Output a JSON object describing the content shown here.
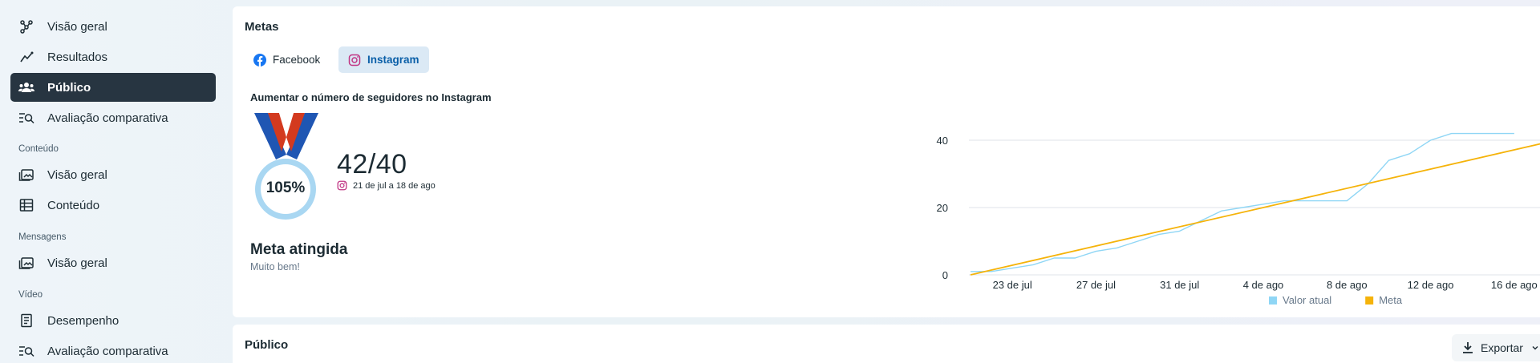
{
  "sidebar": {
    "items": [
      {
        "label": "Visão geral",
        "icon": "nodes-icon"
      },
      {
        "label": "Resultados",
        "icon": "trend-icon"
      },
      {
        "label": "Público",
        "icon": "people-icon",
        "active": true
      },
      {
        "label": "Avaliação comparativa",
        "icon": "benchmark-search-icon"
      }
    ],
    "sections": [
      {
        "title": "Conteúdo",
        "items": [
          {
            "label": "Visão geral",
            "icon": "gallery-icon"
          },
          {
            "label": "Conteúdo",
            "icon": "table-icon"
          }
        ]
      },
      {
        "title": "Mensagens",
        "items": [
          {
            "label": "Visão geral",
            "icon": "gallery-icon"
          }
        ]
      },
      {
        "title": "Vídeo",
        "items": [
          {
            "label": "Desempenho",
            "icon": "document-icon"
          },
          {
            "label": "Avaliação comparativa",
            "icon": "benchmark-search-icon"
          }
        ]
      }
    ]
  },
  "goals": {
    "title": "Metas",
    "tabs": [
      {
        "label": "Facebook",
        "icon": "facebook-icon",
        "selected": false
      },
      {
        "label": "Instagram",
        "icon": "instagram-icon",
        "selected": true
      }
    ],
    "goal_heading": "Aumentar o número de seguidores no Instagram",
    "percent": "105%",
    "progress": "42/40",
    "current": 42,
    "target": 40,
    "date_range": "21 de jul a 18 de ago",
    "status_title": "Meta atingida",
    "status_sub": "Muito bem!"
  },
  "audience": {
    "title": "Público",
    "export_label": "Exportar"
  },
  "colors": {
    "accent_dark": "#273541",
    "current_line": "#8fd6f5",
    "goal_line": "#f5b30a",
    "instagram": "#c13584",
    "facebook": "#1877f2"
  },
  "chart_data": {
    "type": "line",
    "x_ticks": [
      "23 de jul",
      "27 de jul",
      "31 de jul",
      "4 de ago",
      "8 de ago",
      "12 de ago",
      "16 de ago"
    ],
    "y_ticks": [
      0,
      20,
      40
    ],
    "ylim": [
      0,
      40
    ],
    "x_start": "21 de jul",
    "x_end": "18 de ago",
    "grid": true,
    "legend_position": "bottom",
    "series": [
      {
        "name": "Valor atual",
        "color": "#8fd6f5",
        "points": [
          [
            "21 de jul",
            1
          ],
          [
            "22 de jul",
            1
          ],
          [
            "23 de jul",
            2
          ],
          [
            "24 de jul",
            3
          ],
          [
            "25 de jul",
            5
          ],
          [
            "26 de jul",
            5
          ],
          [
            "27 de jul",
            7
          ],
          [
            "28 de jul",
            8
          ],
          [
            "29 de jul",
            10
          ],
          [
            "30 de jul",
            12
          ],
          [
            "31 de jul",
            13
          ],
          [
            "1 de ago",
            16
          ],
          [
            "2 de ago",
            19
          ],
          [
            "3 de ago",
            20
          ],
          [
            "4 de ago",
            21
          ],
          [
            "5 de ago",
            22
          ],
          [
            "6 de ago",
            22
          ],
          [
            "7 de ago",
            22
          ],
          [
            "8 de ago",
            22
          ],
          [
            "9 de ago",
            27
          ],
          [
            "10 de ago",
            34
          ],
          [
            "11 de ago",
            36
          ],
          [
            "12 de ago",
            40
          ],
          [
            "13 de ago",
            42
          ],
          [
            "14 de ago",
            42
          ],
          [
            "15 de ago",
            42
          ],
          [
            "16 de ago",
            42
          ]
        ]
      },
      {
        "name": "Meta",
        "color": "#f5b30a",
        "points": [
          [
            "21 de jul",
            0
          ],
          [
            "18 de ago",
            40
          ]
        ]
      }
    ]
  }
}
